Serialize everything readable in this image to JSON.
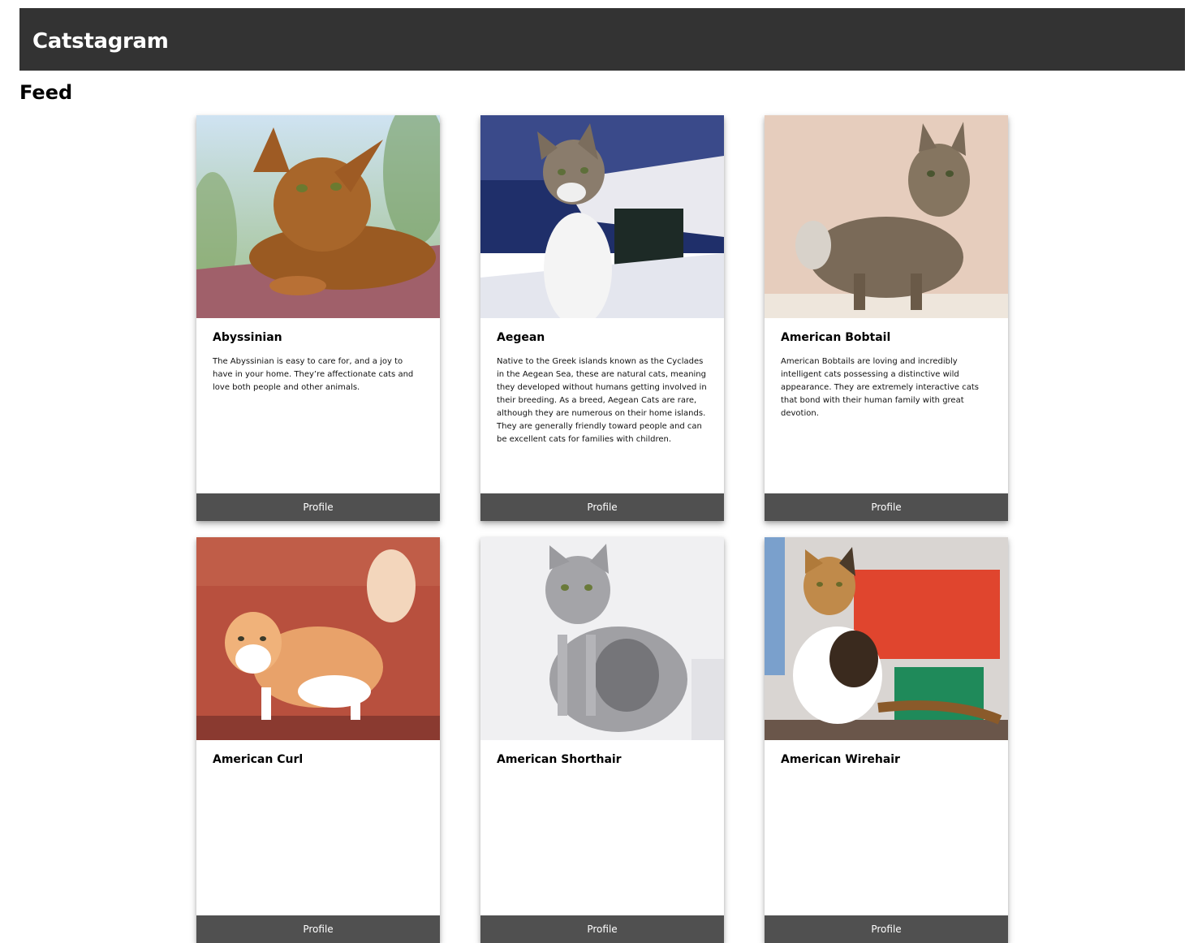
{
  "app": {
    "title": "Catstagram"
  },
  "page": {
    "title": "Feed"
  },
  "cards": [
    {
      "name": "Abyssinian",
      "description": "The Abyssinian is easy to care for, and a joy to have in your home. They’re affectionate cats and love both people and other animals.",
      "button": "Profile"
    },
    {
      "name": "Aegean",
      "description": "Native to the Greek islands known as the Cyclades in the Aegean Sea, these are natural cats, meaning they developed without humans getting involved in their breeding. As a breed, Aegean Cats are rare, although they are numerous on their home islands. They are generally friendly toward people and can be excellent cats for families with children.",
      "button": "Profile"
    },
    {
      "name": "American Bobtail",
      "description": "American Bobtails are loving and incredibly intelligent cats possessing a distinctive wild appearance. They are extremely interactive cats that bond with their human family with great devotion.",
      "button": "Profile"
    },
    {
      "name": "American Curl",
      "description": "",
      "button": "Profile"
    },
    {
      "name": "American Shorthair",
      "description": "",
      "button": "Profile"
    },
    {
      "name": "American Wirehair",
      "description": "",
      "button": "Profile"
    }
  ],
  "colors": {
    "header_bg": "#333333",
    "button_bg": "#505050"
  }
}
